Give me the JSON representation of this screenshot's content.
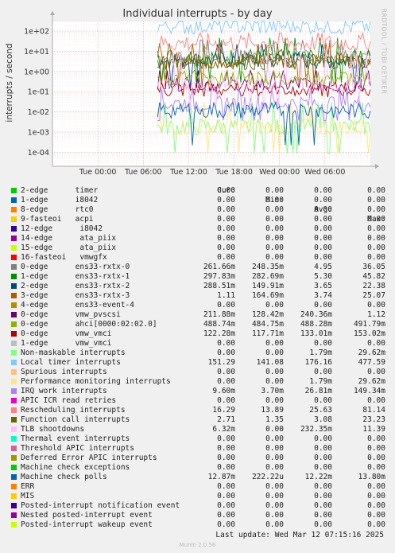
{
  "chart_data": {
    "type": "line",
    "title": "Individual interrupts - by day",
    "ylabel": "interrupts / second",
    "yscale": "log",
    "ylim": [
      2e-05,
      300
    ],
    "yticks": [
      "1e+02",
      "1e+01",
      "1e+00",
      "1e-01",
      "1e-02",
      "1e-03",
      "1e-04"
    ],
    "ytick_values": [
      100,
      10,
      1,
      0.1,
      0.01,
      0.001,
      0.0001
    ],
    "x": [
      "Mon 22:00",
      "Tue 00:00",
      "Tue 06:00",
      "Tue 12:00",
      "Tue 18:00",
      "Wed 00:00",
      "Wed 06:00",
      "Wed 07:15"
    ],
    "xticks": [
      "Tue 00:00",
      "Tue 06:00",
      "Tue 12:00",
      "Tue 18:00",
      "Wed 00:00",
      "Wed 06:00"
    ],
    "grid": true,
    "legend_placement": "bottom",
    "columns": [
      "Cur:",
      "Min:",
      "Avg:",
      "Max:"
    ],
    "series": [
      {
        "name": "2-edge      timer",
        "color": "#00cc00",
        "cur": "0.00",
        "min": "0.00",
        "avg": "0.00",
        "max": "0.00"
      },
      {
        "name": "1-edge      i8042",
        "color": "#0066b3",
        "cur": "0.00",
        "min": "0.00",
        "avg": "0.00",
        "max": "0.00"
      },
      {
        "name": "8-edge      rtc0",
        "color": "#ff8000",
        "cur": "0.00",
        "min": "0.00",
        "avg": "0.00",
        "max": "0.00"
      },
      {
        "name": "9-fasteoi   acpi",
        "color": "#ffcc00",
        "cur": "0.00",
        "min": "0.00",
        "avg": "0.00",
        "max": "0.00"
      },
      {
        "name": "12-edge      i8042",
        "color": "#330099",
        "cur": "0.00",
        "min": "0.00",
        "avg": "0.00",
        "max": "0.00"
      },
      {
        "name": "14-edge      ata_piix",
        "color": "#990099",
        "cur": "0.00",
        "min": "0.00",
        "avg": "0.00",
        "max": "0.00"
      },
      {
        "name": "15-edge      ata_piix",
        "color": "#ccff00",
        "cur": "0.00",
        "min": "0.00",
        "avg": "0.00",
        "max": "0.00"
      },
      {
        "name": "16-fasteoi   vmwgfx",
        "color": "#ff0000",
        "cur": "0.00",
        "min": "0.00",
        "avg": "0.00",
        "max": "0.00"
      },
      {
        "name": "0-edge      ens33-rxtx-0",
        "color": "#808080",
        "cur": "261.66m",
        "min": "248.35m",
        "avg": "4.95",
        "max": "36.05"
      },
      {
        "name": "1-edge      ens33-rxtx-1",
        "color": "#008f00",
        "cur": "297.83m",
        "min": "282.69m",
        "avg": "5.30",
        "max": "45.82"
      },
      {
        "name": "2-edge      ens33-rxtx-2",
        "color": "#00487d",
        "cur": "288.51m",
        "min": "149.91m",
        "avg": "3.65",
        "max": "22.38"
      },
      {
        "name": "3-edge      ens33-rxtx-3",
        "color": "#b35a00",
        "cur": "1.11",
        "min": "164.69m",
        "avg": "3.74",
        "max": "25.07"
      },
      {
        "name": "4-edge      ens33-event-4",
        "color": "#b38f00",
        "cur": "0.00",
        "min": "0.00",
        "avg": "0.00",
        "max": "0.00"
      },
      {
        "name": "0-edge      vmw_pvscsi",
        "color": "#6b006b",
        "cur": "211.88m",
        "min": "128.42m",
        "avg": "240.36m",
        "max": "1.12"
      },
      {
        "name": "0-edge      ahci[0000:02:02.0]",
        "color": "#8fb300",
        "cur": "488.74m",
        "min": "484.75m",
        "avg": "488.28m",
        "max": "491.79m"
      },
      {
        "name": "0-edge      vmw_vmci",
        "color": "#b30000",
        "cur": "122.28m",
        "min": "117.71m",
        "avg": "133.01m",
        "max": "153.02m"
      },
      {
        "name": "1-edge      vmw_vmci",
        "color": "#bebebe",
        "cur": "0.00",
        "min": "0.00",
        "avg": "0.00",
        "max": "0.00"
      },
      {
        "name": "Non-maskable interrupts",
        "color": "#80ff80",
        "cur": "0.00",
        "min": "0.00",
        "avg": "1.79m",
        "max": "29.62m"
      },
      {
        "name": "Local timer interrupts",
        "color": "#80c9ff",
        "cur": "151.29",
        "min": "141.08",
        "avg": "176.16",
        "max": "477.59"
      },
      {
        "name": "Spurious interrupts",
        "color": "#ffc080",
        "cur": "0.00",
        "min": "0.00",
        "avg": "0.00",
        "max": "0.00"
      },
      {
        "name": "Performance monitoring interrupts",
        "color": "#ffe680",
        "cur": "0.00",
        "min": "0.00",
        "avg": "1.79m",
        "max": "29.62m"
      },
      {
        "name": "IRQ work interrupts",
        "color": "#aa80ff",
        "cur": "9.60m",
        "min": "3.70m",
        "avg": "26.81m",
        "max": "149.34m"
      },
      {
        "name": "APIC ICR read retries",
        "color": "#ee00cc",
        "cur": "0.00",
        "min": "0.00",
        "avg": "0.00",
        "max": "0.00"
      },
      {
        "name": "Rescheduling interrupts",
        "color": "#ff8080",
        "cur": "16.29",
        "min": "13.89",
        "avg": "25.63",
        "max": "81.14"
      },
      {
        "name": "Function call interrupts",
        "color": "#666600",
        "cur": "2.71",
        "min": "1.35",
        "avg": "3.08",
        "max": "23.23"
      },
      {
        "name": "TLB shootdowns",
        "color": "#ffbfff",
        "cur": "6.32m",
        "min": "0.00",
        "avg": "232.35m",
        "max": "11.39"
      },
      {
        "name": "Thermal event interrupts",
        "color": "#00ffcc",
        "cur": "0.00",
        "min": "0.00",
        "avg": "0.00",
        "max": "0.00"
      },
      {
        "name": "Threshold APIC interrupts",
        "color": "#cc6699",
        "cur": "0.00",
        "min": "0.00",
        "avg": "0.00",
        "max": "0.00"
      },
      {
        "name": "Deferred Error APIC interrupts",
        "color": "#999900",
        "cur": "0.00",
        "min": "0.00",
        "avg": "0.00",
        "max": "0.00"
      },
      {
        "name": "Machine check exceptions",
        "color": "#00cc00",
        "cur": "0.00",
        "min": "0.00",
        "avg": "0.00",
        "max": "0.00"
      },
      {
        "name": "Machine check polls",
        "color": "#0066b3",
        "cur": "12.87m",
        "min": "222.22u",
        "avg": "12.22m",
        "max": "13.80m"
      },
      {
        "name": "ERR",
        "color": "#ff8000",
        "cur": "0.00",
        "min": "0.00",
        "avg": "0.00",
        "max": "0.00"
      },
      {
        "name": "MIS",
        "color": "#ffcc00",
        "cur": "0.00",
        "min": "0.00",
        "avg": "0.00",
        "max": "0.00"
      },
      {
        "name": "Posted-interrupt notification event",
        "color": "#330099",
        "cur": "0.00",
        "min": "0.00",
        "avg": "0.00",
        "max": "0.00"
      },
      {
        "name": "Nested posted-interrupt event",
        "color": "#990099",
        "cur": "0.00",
        "min": "0.00",
        "avg": "0.00",
        "max": "0.00"
      },
      {
        "name": "Posted-interrupt wakeup event",
        "color": "#ccff00",
        "cur": "0.00",
        "min": "0.00",
        "avg": "0.00",
        "max": "0.00"
      }
    ]
  },
  "last_update": "Last update: Wed Mar 12 07:15:16 2025",
  "watermark": "RRDTOOL / TOBI OETIKER",
  "footer": "Munin 2.0.56"
}
